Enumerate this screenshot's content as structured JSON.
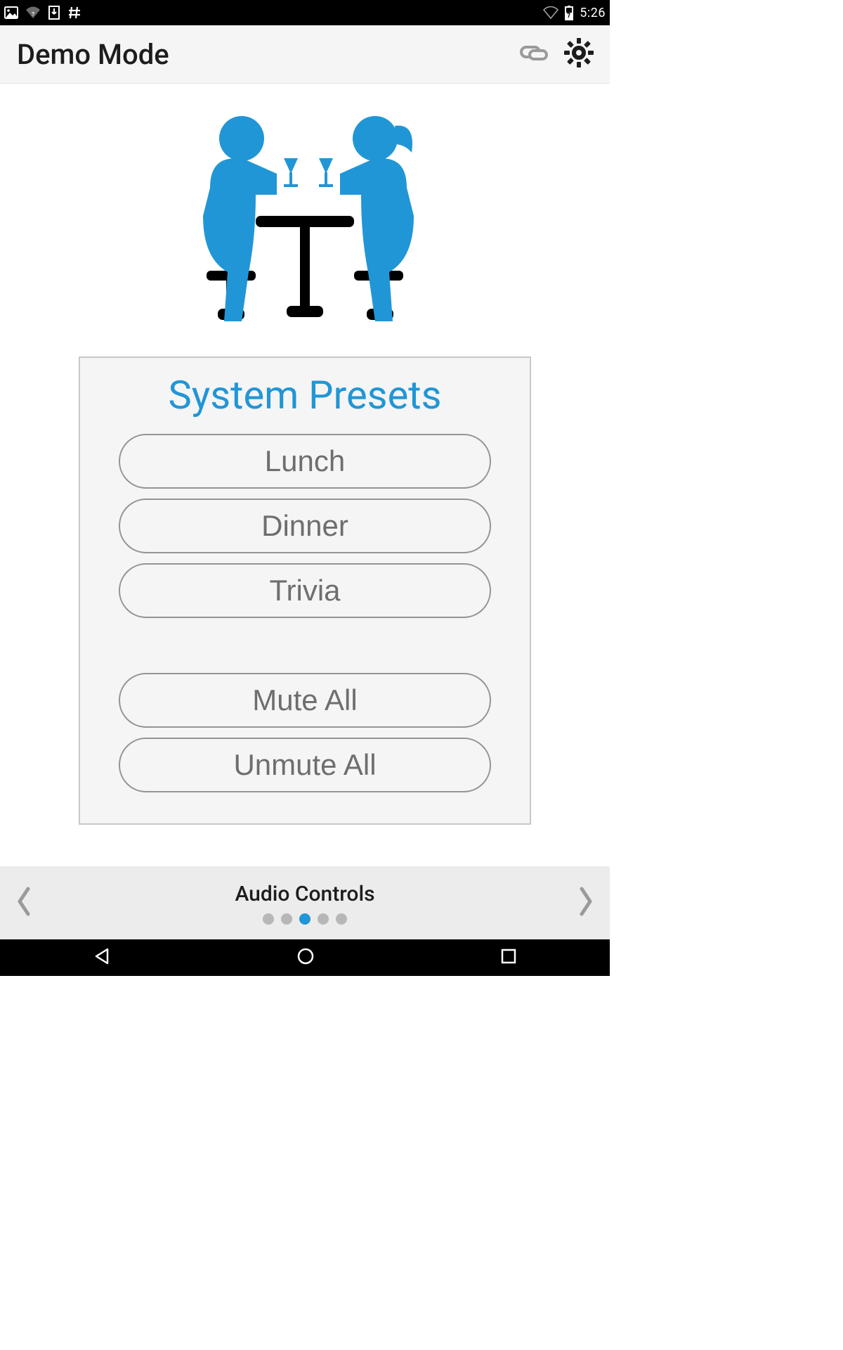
{
  "status": {
    "clock": "5:26"
  },
  "header": {
    "title": "Demo Mode"
  },
  "card": {
    "title": "System Presets",
    "presets": [
      {
        "label": "Lunch"
      },
      {
        "label": "Dinner"
      },
      {
        "label": "Trivia"
      }
    ],
    "actions": [
      {
        "label": "Mute All"
      },
      {
        "label": "Unmute All"
      }
    ]
  },
  "pager": {
    "label": "Audio Controls",
    "dots": 5,
    "active_index": 2
  },
  "colors": {
    "accent": "#2196d6",
    "muted_text": "#6e6e6e",
    "border": "#949494",
    "bg_panel": "#f5f5f5"
  }
}
